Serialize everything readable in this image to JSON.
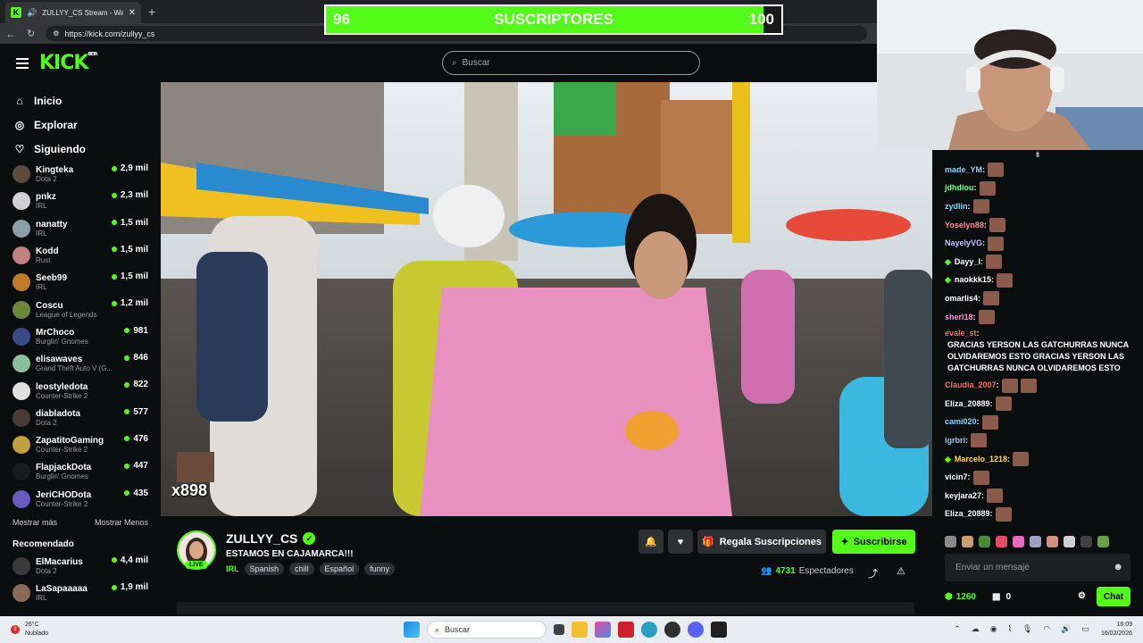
{
  "browser": {
    "tab_title": "ZULLYY_CS Stream - Watch Li",
    "tab_favicon": "K",
    "url": "https://kick.com/zullyy_cs"
  },
  "sub_goal": {
    "current": "96",
    "label": "SUSCRIPTORES",
    "target": "100",
    "progress": 0.96
  },
  "header": {
    "logo": "KICK",
    "beta": "BETA",
    "search_placeholder": "Buscar"
  },
  "nav": [
    {
      "label": "Inicio",
      "icon": "home-icon"
    },
    {
      "label": "Explorar",
      "icon": "compass-icon"
    },
    {
      "label": "Siguiendo",
      "icon": "heart-icon"
    }
  ],
  "following": [
    {
      "name": "Kingteka",
      "game": "Dota 2",
      "viewers": "2,9 mil",
      "color": "#5c4a3a"
    },
    {
      "name": "pnkz",
      "game": "IRL",
      "viewers": "2,3 mil",
      "color": "#d0d0d0"
    },
    {
      "name": "nanatty",
      "game": "IRL",
      "viewers": "1,5 mil",
      "color": "#8aa0a8"
    },
    {
      "name": "Kodd",
      "game": "Rust",
      "viewers": "1,5 mil",
      "color": "#c08080"
    },
    {
      "name": "Seeb99",
      "game": "IRL",
      "viewers": "1,5 mil",
      "color": "#c07a2a"
    },
    {
      "name": "Coscu",
      "game": "League of Legends",
      "viewers": "1,2 mil",
      "color": "#6a8a3a"
    },
    {
      "name": "MrChoco",
      "game": "Burglin' Gnomes",
      "viewers": "981",
      "color": "#3a4a8a"
    },
    {
      "name": "elisawaves",
      "game": "Grand Theft Auto V (G...",
      "viewers": "846",
      "color": "#8ac0a0"
    },
    {
      "name": "leostyledota",
      "game": "Counter-Strike 2",
      "viewers": "822",
      "color": "#e0e0e0"
    },
    {
      "name": "diabladota",
      "game": "Dota 2",
      "viewers": "577",
      "color": "#4a3a3a"
    },
    {
      "name": "ZapatitoGaming",
      "game": "Counter-Strike 2",
      "viewers": "476",
      "color": "#c0a040"
    },
    {
      "name": "FlapjackDota",
      "game": "Burglin' Gnomes",
      "viewers": "447",
      "color": "#1a1a1a"
    },
    {
      "name": "JeriCHODota",
      "game": "Counter-Strike 2",
      "viewers": "435",
      "color": "#6a5ac0"
    }
  ],
  "sidebar_more": "Mostrar más",
  "sidebar_less": "Mostrar Menos",
  "recommended_title": "Recomendado",
  "recommended": [
    {
      "name": "ElMacarius",
      "game": "Dota 2",
      "viewers": "4,4 mil",
      "color": "#3a3a3a"
    },
    {
      "name": "LaSapaaaaa",
      "game": "IRL",
      "viewers": "1,9 mil",
      "color": "#8a6a5a"
    }
  ],
  "video_overlay": {
    "counter": "x898"
  },
  "stream": {
    "name": "ZULLYY_CS",
    "live": "LIVE",
    "title": "ESTAMOS EN CAJAMARCA!!!",
    "category": "IRL",
    "tags": [
      "Spanish",
      "chill",
      "Español",
      "funny"
    ],
    "gift_label": "Regala Suscripciones",
    "subscribe_label": "Suscribirse",
    "viewers": "4731",
    "viewers_label": "Espectadores"
  },
  "chat": {
    "messages": [
      {
        "user": "made_YM",
        "color": "#8ad0ff",
        "text": "",
        "emotes": 1
      },
      {
        "user": "jdhdiou",
        "color": "#7dff8a",
        "text": "",
        "emotes": 1
      },
      {
        "user": "zydlin",
        "color": "#7dd8ff",
        "text": "",
        "emotes": 1
      },
      {
        "user": "Yoselyn88",
        "color": "#ff8a9a",
        "text": "",
        "emotes": 1
      },
      {
        "user": "NayelyVG",
        "color": "#c0c0ff",
        "text": "",
        "emotes": 1
      },
      {
        "user": "Dayy_l",
        "color": "#ffffff",
        "text": "",
        "emotes": 1,
        "badge": true
      },
      {
        "user": "naokkk15",
        "color": "#ffffff",
        "text": "",
        "emotes": 1,
        "badge": true
      },
      {
        "user": "omarlis4",
        "color": "#ffffff",
        "text": "",
        "emotes": 1
      },
      {
        "user": "sherl18",
        "color": "#ff8ad0",
        "text": "",
        "emotes": 1
      },
      {
        "user": "evale_st",
        "color": "#ff6a6a",
        "text": "GRACIAS YERSON LAS GATCHURRAS NUNCA OLVIDAREMOS ESTO GRACIAS YERSON LAS GATCHURRAS NUNCA OLVIDAREMOS ESTO",
        "emotes": 0
      },
      {
        "user": "Claudia_2007",
        "color": "#ff6a6a",
        "text": "",
        "emotes": 2
      },
      {
        "user": "Eliza_20889",
        "color": "#ffffff",
        "text": "",
        "emotes": 1
      },
      {
        "user": "cami020",
        "color": "#8ad0ff",
        "text": "",
        "emotes": 1
      },
      {
        "user": "igrbri",
        "color": "#8ad0ff",
        "text": "",
        "emotes": 1
      },
      {
        "user": "Marcelo_1218",
        "color": "#ffd84a",
        "text": "",
        "emotes": 1,
        "badge": true
      },
      {
        "user": "vicin7",
        "color": "#ffffff",
        "text": "",
        "emotes": 1
      },
      {
        "user": "keyjara27",
        "color": "#ffffff",
        "text": "",
        "emotes": 1
      },
      {
        "user": "Eliza_20889",
        "color": "#ffffff",
        "text": "",
        "emotes": 1
      }
    ],
    "input_placeholder": "Enviar un mensaje",
    "points": "1260",
    "store_count": "0",
    "send_label": "Chat"
  },
  "taskbar": {
    "temperature": "26°C",
    "weather": "Nublado",
    "search": "Buscar",
    "time": "16:09",
    "date": "16/02/2026",
    "notification_count": "2"
  }
}
